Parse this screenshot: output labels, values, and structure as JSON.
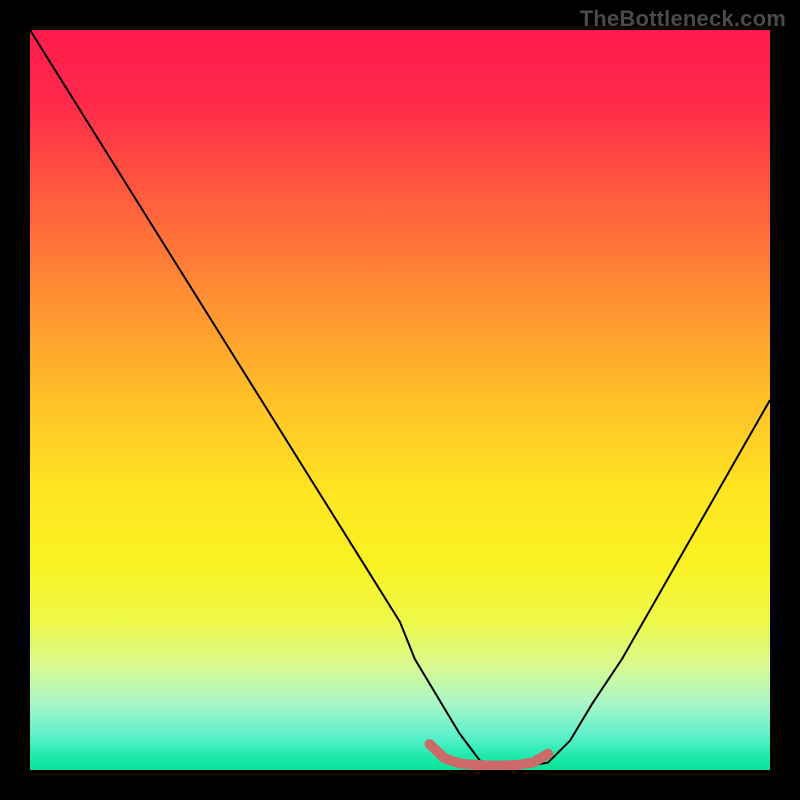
{
  "watermark": "TheBottleneck.com",
  "chart_data": {
    "type": "line",
    "title": "",
    "xlabel": "",
    "ylabel": "",
    "xlim": [
      0,
      100
    ],
    "ylim": [
      0,
      100
    ],
    "background_gradient": {
      "stops": [
        {
          "pos": 0.0,
          "color": "#ff1a4d"
        },
        {
          "pos": 0.1,
          "color": "#ff2a4a"
        },
        {
          "pos": 0.22,
          "color": "#ff5a3e"
        },
        {
          "pos": 0.35,
          "color": "#ff8b33"
        },
        {
          "pos": 0.5,
          "color": "#ffc028"
        },
        {
          "pos": 0.62,
          "color": "#ffe422"
        },
        {
          "pos": 0.72,
          "color": "#f9f222"
        },
        {
          "pos": 0.8,
          "color": "#eef84a"
        },
        {
          "pos": 0.86,
          "color": "#d8fa90"
        },
        {
          "pos": 0.91,
          "color": "#a9f6c8"
        },
        {
          "pos": 0.955,
          "color": "#5af0cc"
        },
        {
          "pos": 0.985,
          "color": "#18e9a8"
        },
        {
          "pos": 1.0,
          "color": "#0be39a"
        }
      ]
    },
    "series": [
      {
        "name": "bottleneck-curve",
        "color": "#000000",
        "width": 2,
        "x": [
          0,
          5,
          10,
          15,
          20,
          25,
          30,
          35,
          40,
          45,
          50,
          52,
          55,
          58,
          61,
          64,
          67,
          70,
          73,
          76,
          80,
          84,
          88,
          92,
          96,
          100
        ],
        "y": [
          100,
          92,
          84,
          76,
          68,
          60,
          52,
          44,
          36,
          28,
          20,
          15,
          10,
          5,
          1,
          0.5,
          0.5,
          1,
          4,
          9,
          15,
          22,
          29,
          36,
          43,
          50
        ]
      },
      {
        "name": "optimal-range-marker",
        "color": "#cc6a6a",
        "width": 10,
        "linecap": "round",
        "x": [
          54,
          56,
          58,
          60,
          62,
          64,
          66,
          68,
          70
        ],
        "y": [
          3.5,
          1.6,
          0.9,
          0.7,
          0.6,
          0.6,
          0.7,
          1.0,
          2.2
        ]
      }
    ]
  }
}
